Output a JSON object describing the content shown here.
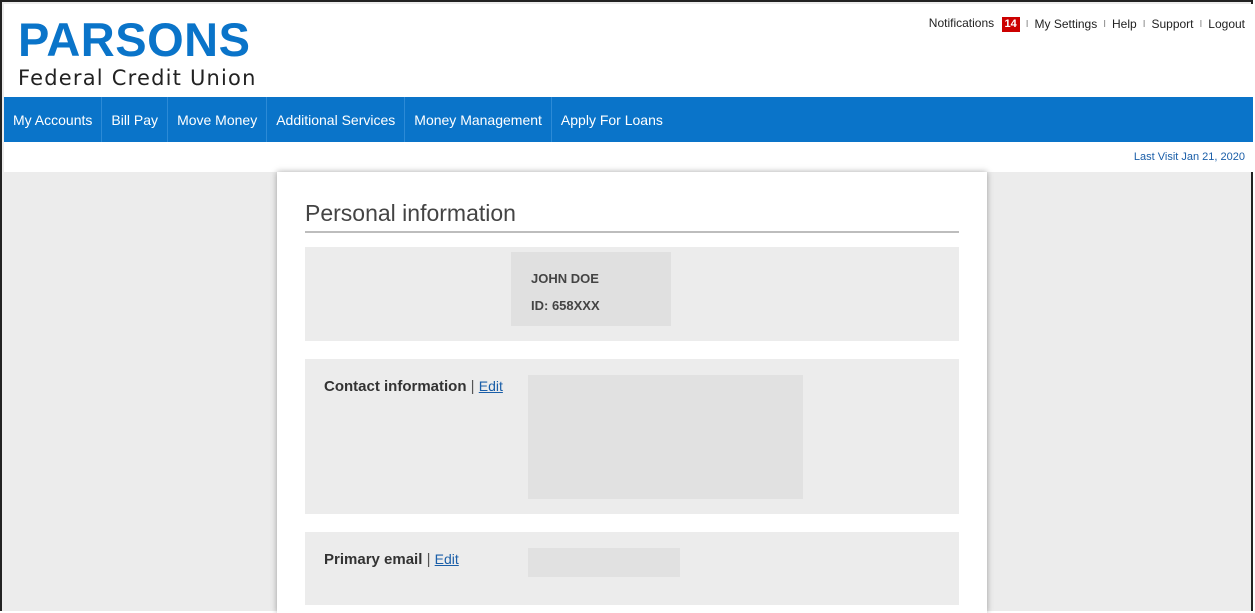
{
  "brand": {
    "name": "PARSONS",
    "subtitle": "Federal Credit Union",
    "color": "#0a74c9"
  },
  "utility_links": {
    "notifications_label": "Notifications",
    "notifications_count": "14",
    "settings": "My Settings",
    "help": "Help",
    "support": "Support",
    "logout": "Logout",
    "separator": "I"
  },
  "nav": {
    "items": [
      {
        "label": "My Accounts"
      },
      {
        "label": "Bill Pay"
      },
      {
        "label": "Move Money"
      },
      {
        "label": "Additional Services"
      },
      {
        "label": "Money Management"
      },
      {
        "label": "Apply For Loans"
      }
    ]
  },
  "last_visit": "Last Visit Jan 21, 2020",
  "personal": {
    "title": "Personal information",
    "name": "JOHN DOE",
    "id": "ID: 658XXX",
    "contact_label": "Contact information",
    "primary_email_label": "Primary email",
    "separator": "|",
    "edit_label": "Edit"
  }
}
